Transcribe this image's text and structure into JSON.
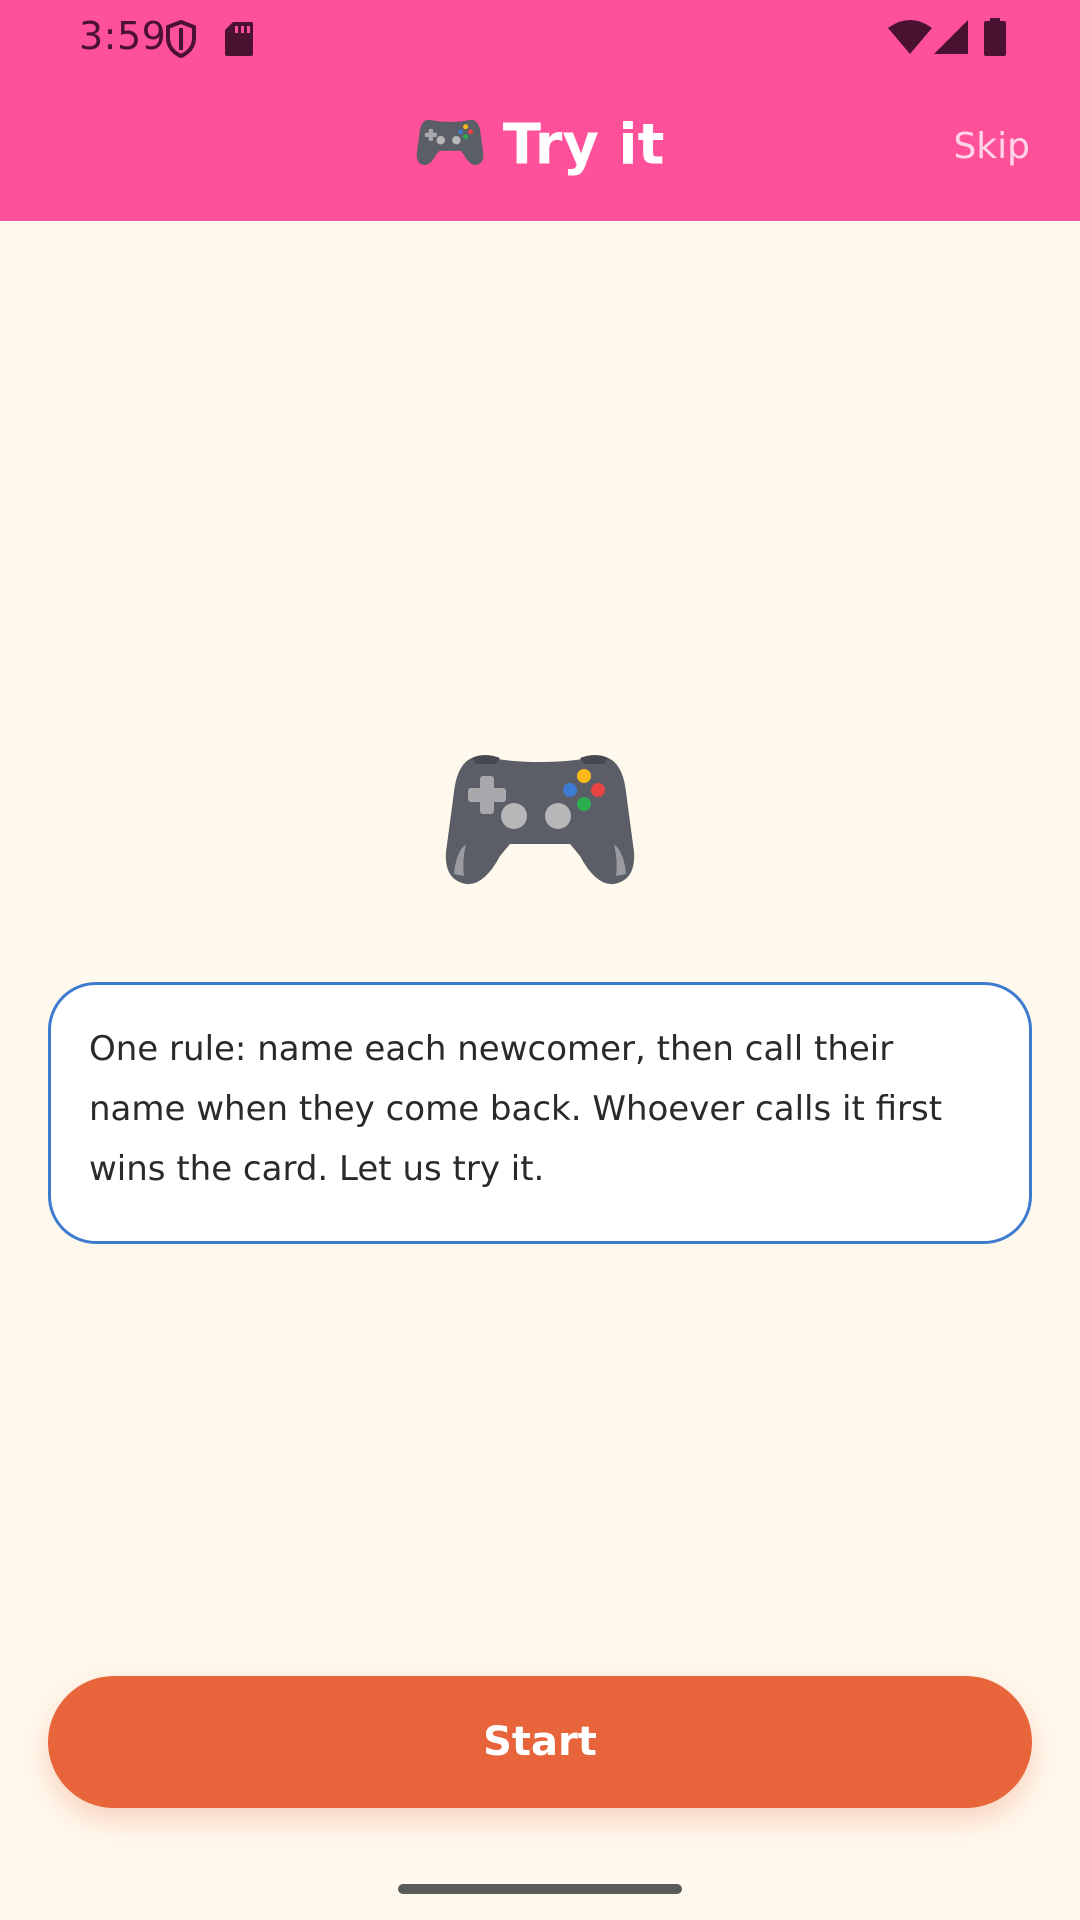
{
  "status_bar": {
    "time": "3:59",
    "icons": [
      "shield-icon",
      "sd-card-icon",
      "wifi-icon",
      "signal-icon",
      "battery-icon"
    ]
  },
  "header": {
    "title": "Try it",
    "title_icon": "game-controller-icon",
    "skip_label": "Skip"
  },
  "main": {
    "hero_icon": "game-controller-icon",
    "message": "One rule: name each newcomer, then call their name when they come back. Whoever calls it first wins the card. Let us try it."
  },
  "footer": {
    "start_label": "Start"
  },
  "colors": {
    "header": "#ff509a",
    "background": "#fff8ec",
    "accent_button": "#e8653c",
    "message_border": "#3d7bd0"
  }
}
